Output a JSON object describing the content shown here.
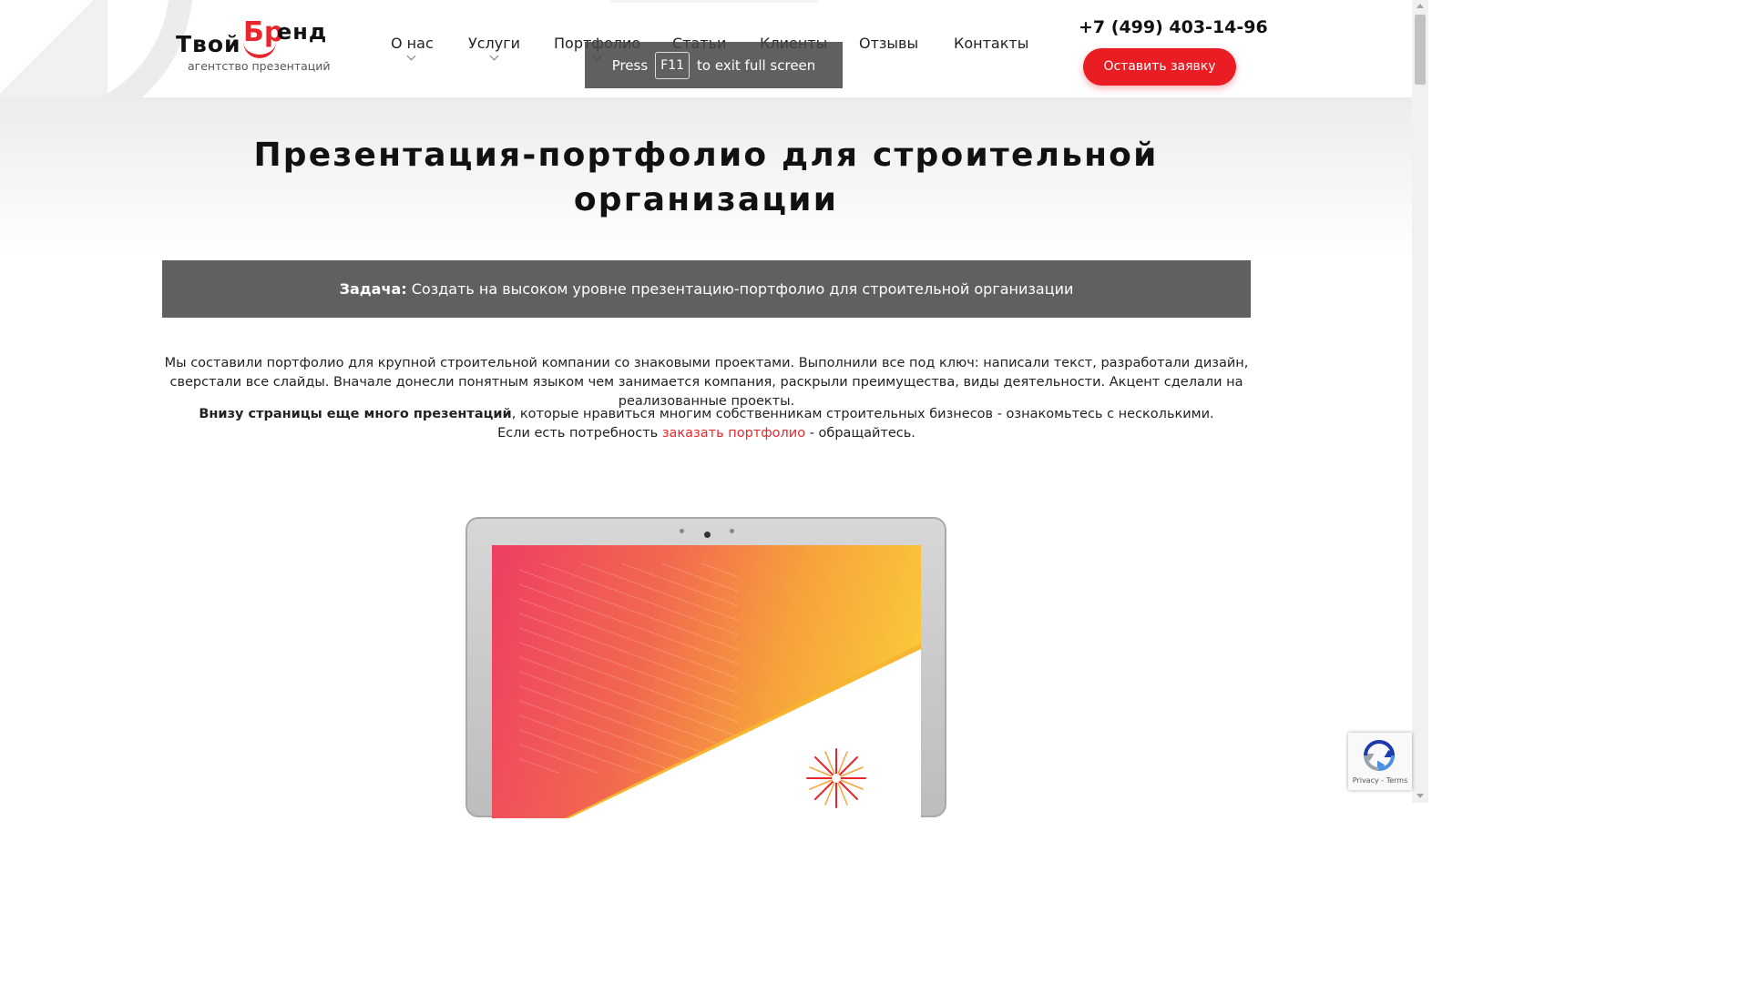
{
  "header": {
    "logo": {
      "part1": "Твой",
      "part2": "Бр",
      "part3": "енд",
      "subtitle": "агентство презентаций"
    },
    "nav": [
      {
        "label": "О нас",
        "has_dropdown": true
      },
      {
        "label": "Услуги",
        "has_dropdown": true
      },
      {
        "label": "Портфолио",
        "has_dropdown": true
      },
      {
        "label": "Статьи",
        "has_dropdown": false
      },
      {
        "label": "Клиенты",
        "has_dropdown": false
      },
      {
        "label": "Отзывы",
        "has_dropdown": false
      },
      {
        "label": "Контакты",
        "has_dropdown": false
      }
    ],
    "phone": "+7 (499) 403-14-96",
    "cta_label": "Оставить заявку",
    "accent_color": "#ea1c24"
  },
  "fullscreen_notice": {
    "press": "Press",
    "key": "F11",
    "rest": "to exit full screen"
  },
  "main": {
    "title": "Презентация-портфолио для строительной организации",
    "task_label": "Задача:",
    "task_text": " Создать на высоком уровне презентацию-портфолио для строительной организации",
    "description": "Мы составили портфолио для крупной строительной компании со знаковыми проектами. Выполнили все под ключ: написали текст, разработали дизайн, сверстали все слайды. Вначале донесли понятным языком чем занимается компания, раскрыли преимущества, виды деятельности. Акцент сделали на реализованные проекты.",
    "note_bold": "Внизу страницы еще много презентаций",
    "note_rest": ", которые нравиться многим собственникам строительных бизнесов - ознакомьтесь с несколькими.",
    "order_prefix": "Если есть потребность ",
    "order_link": "заказать портфолио",
    "order_suffix": " - обращайтесь."
  },
  "recaptcha": {
    "text": "Privacy - Terms"
  }
}
